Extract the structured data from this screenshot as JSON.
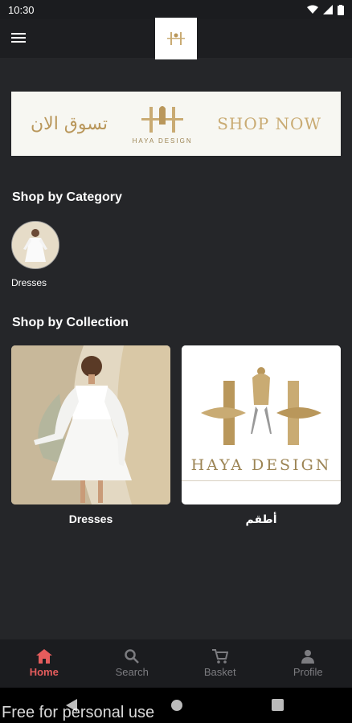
{
  "status_bar": {
    "time": "10:30"
  },
  "banner": {
    "arabic_text": "تسوق الان",
    "brand": "HAYA DESIGN",
    "shop_now": "SHOP NOW"
  },
  "sections": {
    "category_title": "Shop by Category",
    "collection_title": "Shop by Collection"
  },
  "categories": [
    {
      "label": "Dresses"
    }
  ],
  "collections": [
    {
      "label": "Dresses"
    },
    {
      "label": "أطقم",
      "logo_text": "HAYA DESIGN"
    }
  ],
  "bottom_nav": {
    "items": [
      {
        "label": "Home",
        "icon": "home-icon",
        "active": true
      },
      {
        "label": "Search",
        "icon": "search-icon"
      },
      {
        "label": "Basket",
        "icon": "cart-icon"
      },
      {
        "label": "Profile",
        "icon": "profile-icon"
      }
    ]
  },
  "watermark": "Free for personal use",
  "colors": {
    "accent": "#e45c5c",
    "gold": "#b9975b",
    "background": "#252629"
  }
}
